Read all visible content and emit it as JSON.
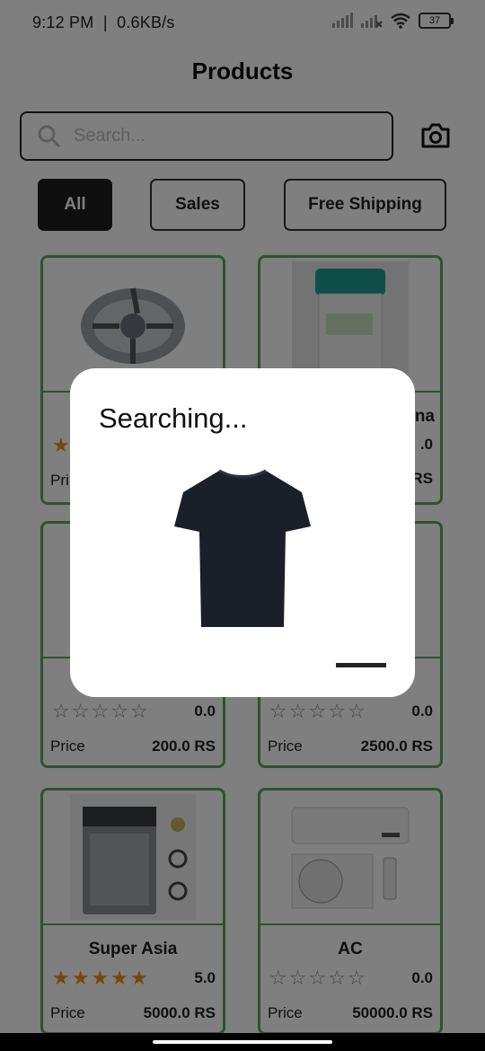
{
  "status_bar": {
    "time": "9:12 PM",
    "speed": "0.6KB/s",
    "battery": "37"
  },
  "page": {
    "title": "Products"
  },
  "search": {
    "placeholder": "Search..."
  },
  "filters": [
    {
      "label": "All",
      "active": true
    },
    {
      "label": "Sales",
      "active": false
    },
    {
      "label": "Free Shipping",
      "active": false
    }
  ],
  "products": [
    {
      "name": "",
      "rating": "",
      "rating_stars": 1,
      "price_label": "Pri",
      "price": "",
      "image": "washing-machine-part-image"
    },
    {
      "name": "na",
      "rating": ".0",
      "rating_stars": 0,
      "price_label": "",
      "price": "RS",
      "image": "water-cooler-image"
    },
    {
      "name": "",
      "rating": "0.0",
      "rating_stars": 0,
      "price_label": "Price",
      "price": "200.0 RS",
      "image": ""
    },
    {
      "name": "",
      "rating": "0.0",
      "rating_stars": 0,
      "price_label": "Price",
      "price": "2500.0 RS",
      "image": ""
    },
    {
      "name": "Super Asia",
      "rating": "5.0",
      "rating_stars": 5,
      "price_label": "Price",
      "price": "5000.0 RS",
      "image": "washing-machine-image"
    },
    {
      "name": "AC",
      "rating": "0.0",
      "rating_stars": 0,
      "price_label": "Price",
      "price": "50000.0 RS",
      "image": "air-conditioner-image"
    }
  ],
  "dialog": {
    "title": "Searching..."
  },
  "colors": {
    "accent_border": "#5aa95a",
    "star": "#e8921a",
    "chip_active": "#1e1e1e"
  }
}
